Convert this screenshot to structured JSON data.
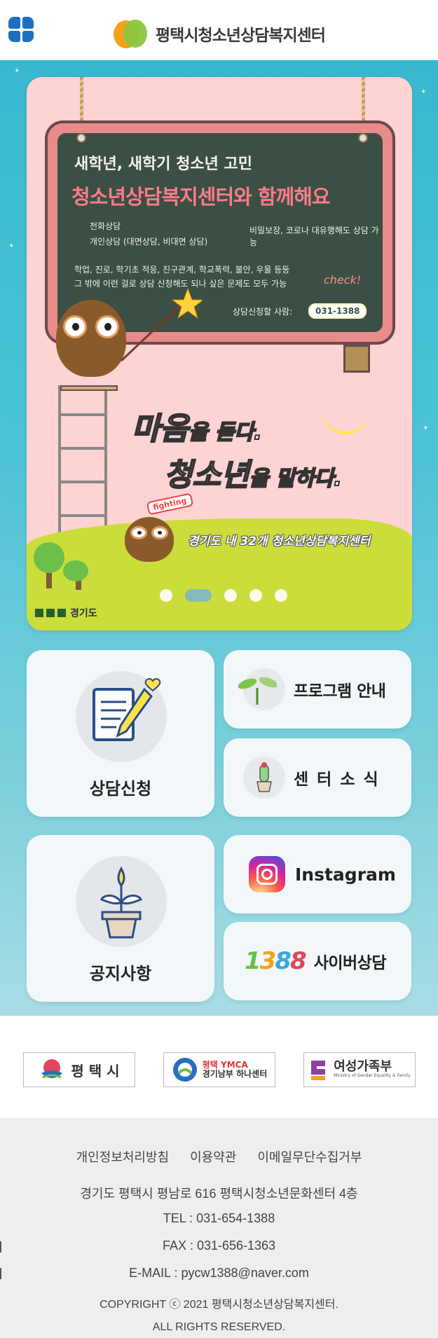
{
  "header": {
    "menu_icon": "grid-menu-icon",
    "logo_text": "평택시청소년상담복지센터",
    "logo_colors": [
      "#f5a11c",
      "#8cc63f"
    ]
  },
  "banner": {
    "line1": "새학년, 새학기 청소년 고민",
    "line2": "청소년상담복지센터와 함께해요",
    "note_phone": "전화상담",
    "note_personal": "개인상담 (대면상담, 비대면 상담)",
    "note_secret": "비밀보장, 코로나 대유행해도 상담 가능",
    "note_topics": "학업, 진로, 학기초 적응, 친구관계, 학교폭력, 불안, 우울 등등",
    "note_other": "그 밖에 이런 걸로 상담 신청해도 되나 싶은 문제도 모두 가능",
    "check": "check!",
    "apply_label": "상담신청할 사람:",
    "apply_phone": "031-1388",
    "slogan1_big": "마음",
    "slogan1_small": "을 듣다.",
    "slogan2_big": "청소년",
    "slogan2_small": "을 말하다.",
    "fighting": "fighting",
    "tagline": "경기도 내 32개 청소년상담복지센터",
    "org_logo": "경기도",
    "slides_total": 5,
    "slide_active": 2
  },
  "quick_menu": {
    "counsel": "상담신청",
    "program": "프로그램 안내",
    "news": "센 터 소 식",
    "notice": "공지사항",
    "instagram": "Instagram",
    "cyber_prefix": "1388",
    "cyber": "사이버상담"
  },
  "partners": {
    "p1": "평 택 시",
    "p2_line1": "평택 YMCA",
    "p2_line2": "경기남부 하나센터",
    "p3": "여성가족부",
    "p3_sub": "Ministry of Gender Equality & Family"
  },
  "footer": {
    "link_privacy": "개인정보처리방침",
    "link_terms": "이용약관",
    "link_email": "이메일무단수집거부",
    "address": "경기도 평택시 평남로 616 평택시청소년문화센터 4층",
    "tel": "TEL : 031-654-1388",
    "fax": "FAX : 031-656-1363",
    "email": "E-MAIL : pycw1388@naver.com",
    "copyright": "COPYRIGHT ⓒ 2021 평택시청소년상담복지센터.",
    "rights": "ALL RIGHTS RESERVED."
  }
}
